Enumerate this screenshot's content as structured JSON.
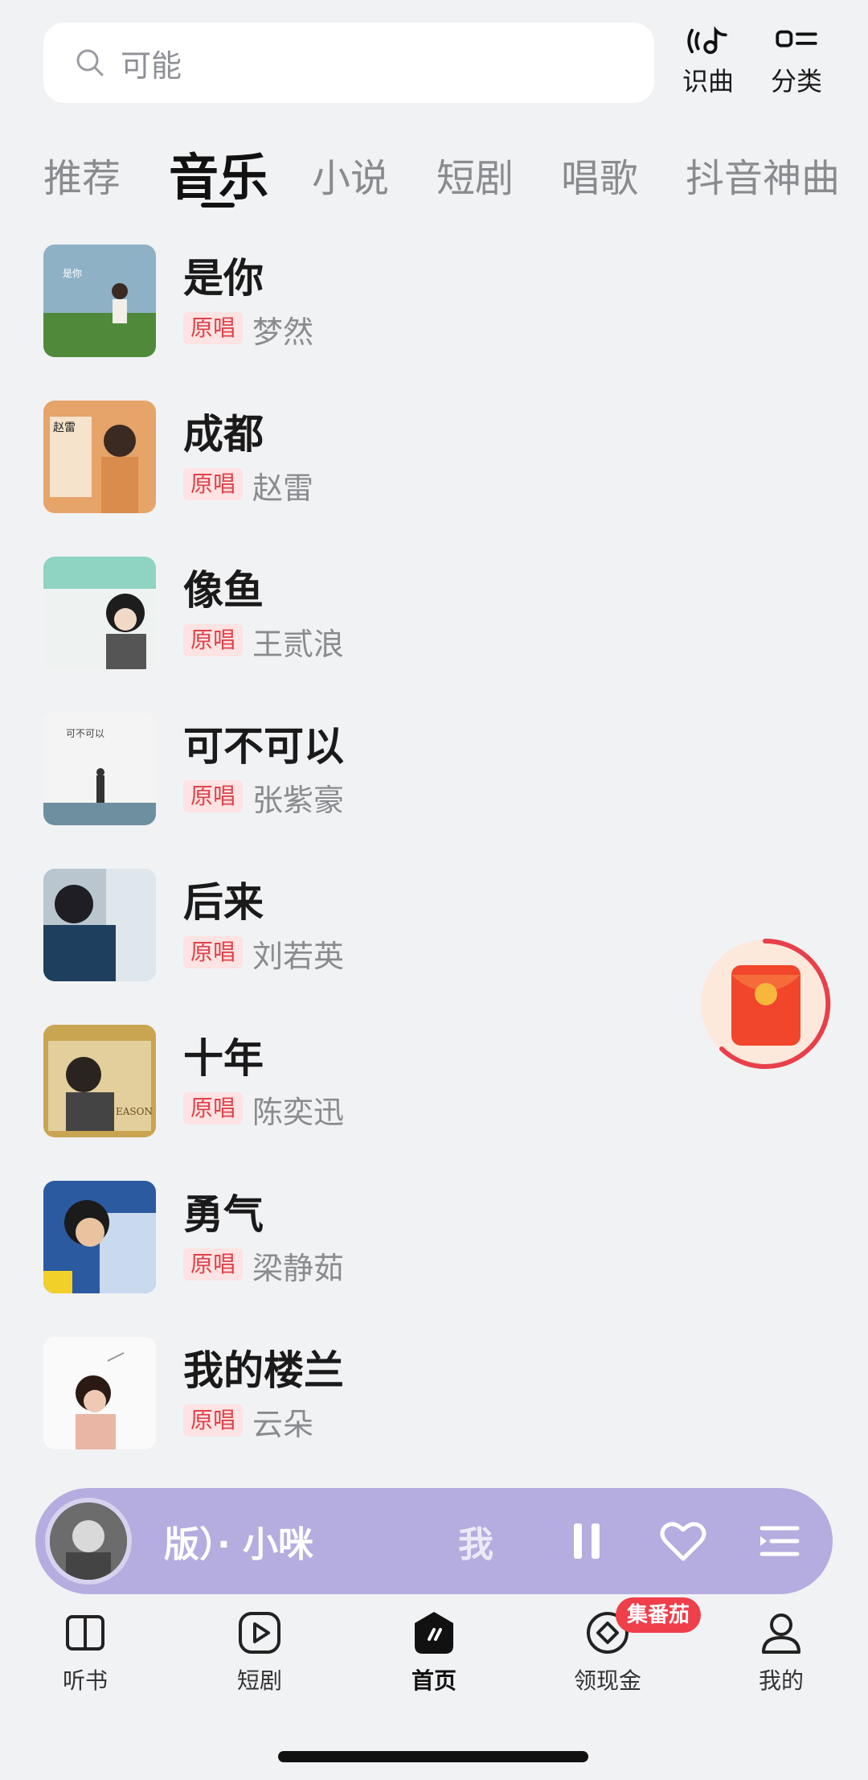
{
  "search": {
    "placeholder": "可能"
  },
  "top_actions": {
    "recognize_label": "识曲",
    "category_label": "分类"
  },
  "tabs": [
    {
      "label": "推荐",
      "active": false
    },
    {
      "label": "音乐",
      "active": true
    },
    {
      "label": "小说",
      "active": false
    },
    {
      "label": "短剧",
      "active": false
    },
    {
      "label": "唱歌",
      "active": false
    },
    {
      "label": "抖音神曲",
      "active": false
    }
  ],
  "songs": [
    {
      "title": "是你",
      "tag": "原唱",
      "artist": "梦然"
    },
    {
      "title": "成都",
      "tag": "原唱",
      "artist": "赵雷"
    },
    {
      "title": "像鱼",
      "tag": "原唱",
      "artist": "王贰浪"
    },
    {
      "title": "可不可以",
      "tag": "原唱",
      "artist": "张紫豪"
    },
    {
      "title": "后来",
      "tag": "原唱",
      "artist": "刘若英"
    },
    {
      "title": "十年",
      "tag": "原唱",
      "artist": "陈奕迅"
    },
    {
      "title": "勇气",
      "tag": "原唱",
      "artist": "梁静茹"
    },
    {
      "title": "我的楼兰",
      "tag": "原唱",
      "artist": "云朵"
    }
  ],
  "player": {
    "ticker_text": "版）· 小咪",
    "ticker_text_next": "我"
  },
  "bottom_nav": {
    "items": [
      {
        "label": "听书",
        "icon": "book-icon"
      },
      {
        "label": "短剧",
        "icon": "play-icon"
      },
      {
        "label": "首页",
        "icon": "home-logo-icon",
        "active": true
      },
      {
        "label": "领现金",
        "icon": "coin-icon"
      },
      {
        "label": "我的",
        "icon": "user-icon"
      }
    ],
    "badge": "集番茄"
  },
  "colors": {
    "accent_red": "#e0424a",
    "tag_bg": "#fde3e3",
    "player_bg": "#b5acdf",
    "page_bg": "#f1f2f4"
  }
}
